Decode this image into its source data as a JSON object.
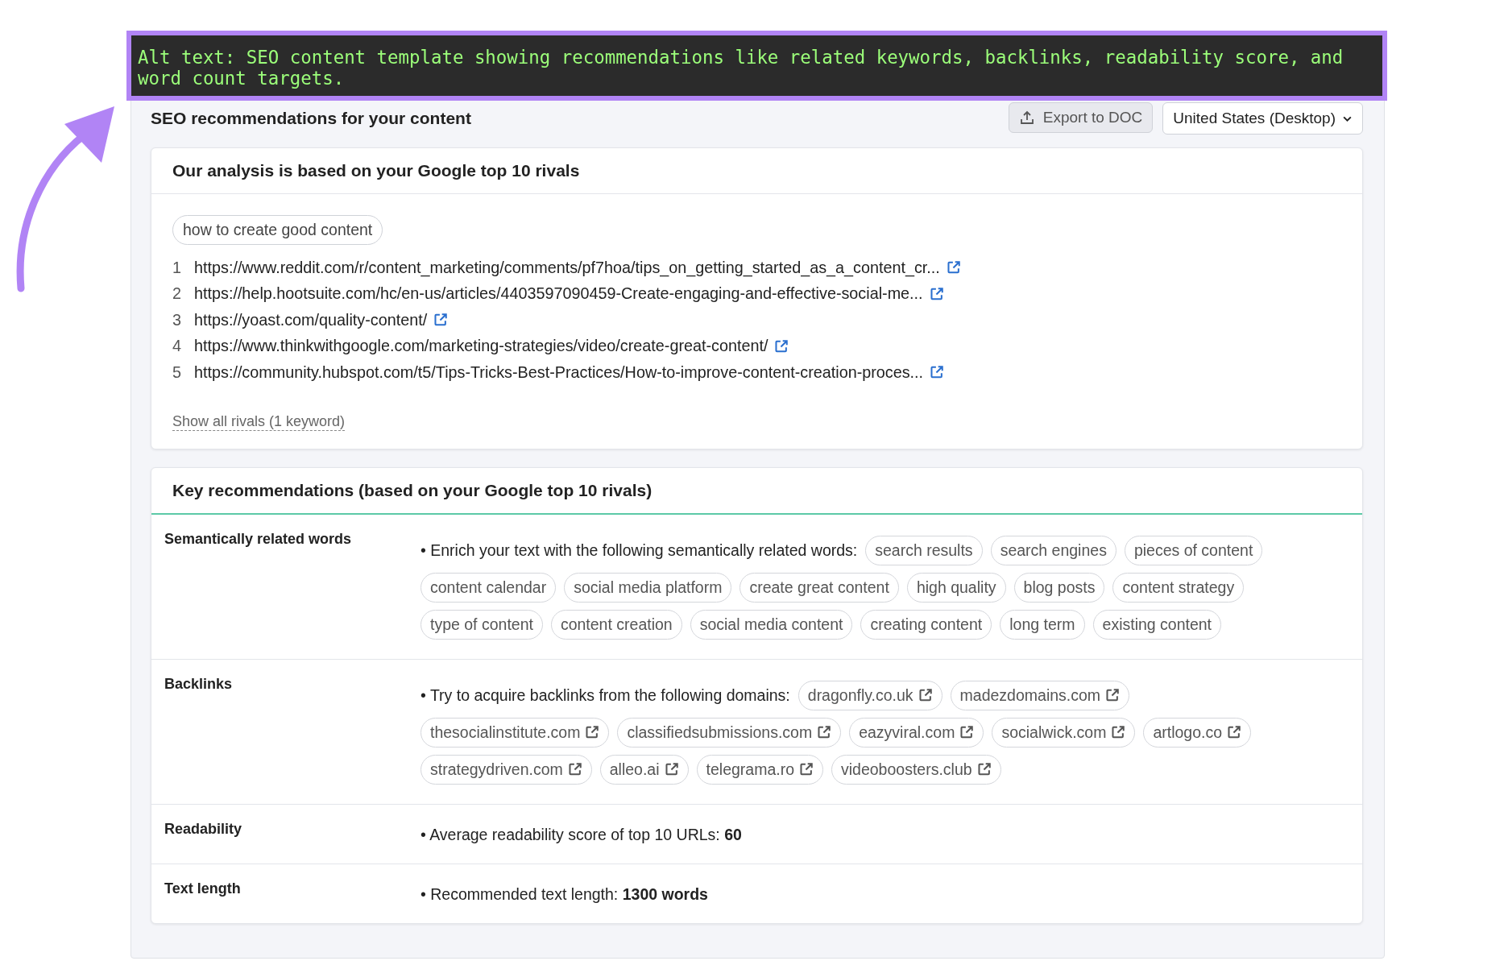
{
  "annotation": {
    "text": "Alt text: SEO content template showing recommendations like related keywords, backlinks, readability score, and word count targets."
  },
  "header": {
    "title": "SEO recommendations for your content",
    "export_button": "Export to DOC",
    "region_select": "United States (Desktop)"
  },
  "rivals": {
    "title": "Our analysis is based on your Google top 10 rivals",
    "keyword": "how to create good content",
    "urls": [
      {
        "number": "1",
        "url": "https://www.reddit.com/r/content_marketing/comments/pf7hoa/tips_on_getting_started_as_a_content_cr..."
      },
      {
        "number": "2",
        "url": "https://help.hootsuite.com/hc/en-us/articles/4403597090459-Create-engaging-and-effective-social-me..."
      },
      {
        "number": "3",
        "url": "https://yoast.com/quality-content/"
      },
      {
        "number": "4",
        "url": "https://www.thinkwithgoogle.com/marketing-strategies/video/create-great-content/"
      },
      {
        "number": "5",
        "url": "https://community.hubspot.com/t5/Tips-Tricks-Best-Practices/How-to-improve-content-creation-proces..."
      }
    ],
    "show_all": "Show all rivals (1 keyword)"
  },
  "recommendations": {
    "title": "Key recommendations (based on your Google top 10 rivals)",
    "rows": [
      {
        "kind": "words",
        "label": "Semantically related words",
        "intro": "• Enrich your text with the following semantically related words:",
        "tags": [
          "search results",
          "search engines",
          "pieces of content",
          "content calendar",
          "social media platform",
          "create great content",
          "high quality",
          "blog posts",
          "content strategy",
          "type of content",
          "content creation",
          "social media content",
          "creating content",
          "long term",
          "existing content"
        ]
      },
      {
        "kind": "links",
        "label": "Backlinks",
        "intro": "• Try to acquire backlinks from the following domains:",
        "tags": [
          "dragonfly.co.uk",
          "madezdomains.com",
          "thesocialinstitute.com",
          "classifiedsubmissions.com",
          "eazyviral.com",
          "socialwick.com",
          "artlogo.co",
          "strategydriven.com",
          "alleo.ai",
          "telegrama.ro",
          "videoboosters.club"
        ]
      },
      {
        "kind": "value",
        "label": "Readability",
        "text": "• Average readability score of top 10 URLs: **60**"
      },
      {
        "kind": "value",
        "label": "Text length",
        "text": "• Recommended text length: **1300 words**"
      }
    ]
  }
}
